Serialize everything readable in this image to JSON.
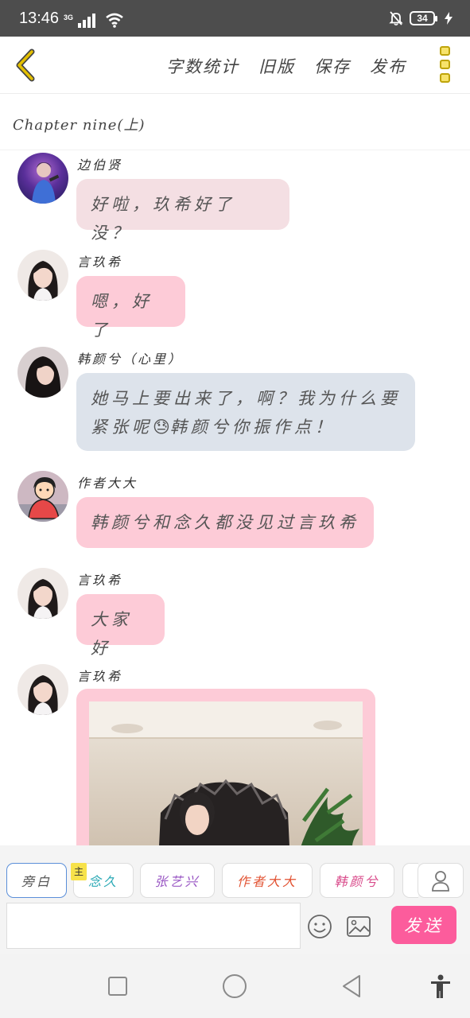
{
  "status_bar": {
    "time": "13:46",
    "network": "3G",
    "battery": "34"
  },
  "header": {
    "actions": [
      "字数统计",
      "旧版",
      "保存",
      "发布"
    ]
  },
  "chapter": {
    "title": "Chapter nine(上)"
  },
  "messages": [
    {
      "sender": "边伯贤",
      "text": "好啦，玖希好了没？",
      "style": "pale"
    },
    {
      "sender": "言玖希",
      "text": "嗯，好了",
      "style": "pink"
    },
    {
      "sender": "韩颜兮（心里）",
      "text_line1": "她马上要出来了，啊？我为什么要",
      "text_line2_a": "紧张呢",
      "text_line2_b": "韩颜兮你振作点！",
      "emoji": "😓",
      "style": "blue"
    },
    {
      "sender": "作者大大",
      "text": "韩颜兮和念久都没见过言玖希",
      "style": "pink"
    },
    {
      "sender": "言玖希",
      "text": "大家好",
      "style": "pink"
    },
    {
      "sender": "言玖希",
      "type": "image"
    }
  ],
  "roles": [
    {
      "label": "旁白",
      "color": "#555555"
    },
    {
      "label": "念久",
      "color": "#2aa9b5",
      "badge": "主"
    },
    {
      "label": "张艺兴",
      "color": "#9a58c4"
    },
    {
      "label": "作者大大",
      "color": "#e25333"
    },
    {
      "label": "韩颜兮",
      "color": "#d94a8a"
    }
  ],
  "input": {
    "value": "",
    "placeholder": ""
  },
  "send_label": "发送",
  "colors": {
    "accent": "#fc5c9c",
    "bubble_pink": "#fdcbd7",
    "bubble_blue": "#dde3eb",
    "back_arrow": "#d8b300"
  }
}
